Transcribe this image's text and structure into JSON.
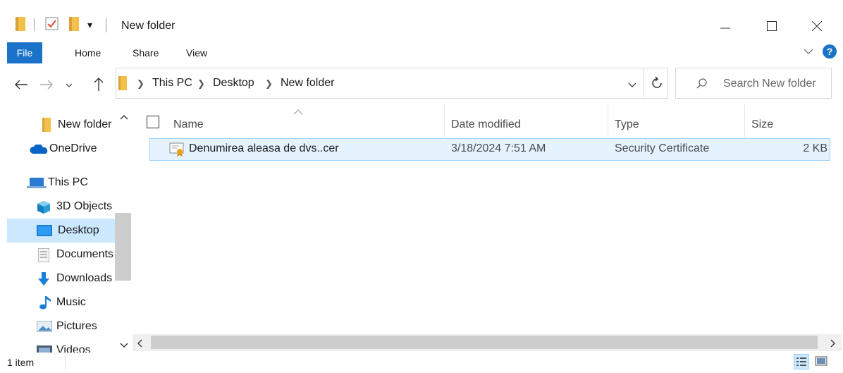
{
  "title": "New folder",
  "ribbon": {
    "tabs": [
      "File",
      "Home",
      "Share",
      "View"
    ]
  },
  "address": {
    "crumbs": [
      "This PC",
      "Desktop",
      "New folder"
    ]
  },
  "search": {
    "placeholder": "Search New folder"
  },
  "nav": {
    "items": [
      "New folder",
      "OneDrive",
      "This PC",
      "3D Objects",
      "Desktop",
      "Documents",
      "Downloads",
      "Music",
      "Pictures",
      "Videos"
    ],
    "selected": "Desktop"
  },
  "columns": {
    "name": "Name",
    "date": "Date modified",
    "type": "Type",
    "size": "Size"
  },
  "files": [
    {
      "name": "Denumirea aleasa de dvs..cer",
      "date": "3/18/2024 7:51 AM",
      "type": "Security Certificate",
      "size": "2 KB"
    }
  ],
  "status": {
    "count": "1 item"
  },
  "colors": {
    "accent": "#1a73c8",
    "folder": "#f3c14a",
    "selection": "#cce8ff"
  }
}
